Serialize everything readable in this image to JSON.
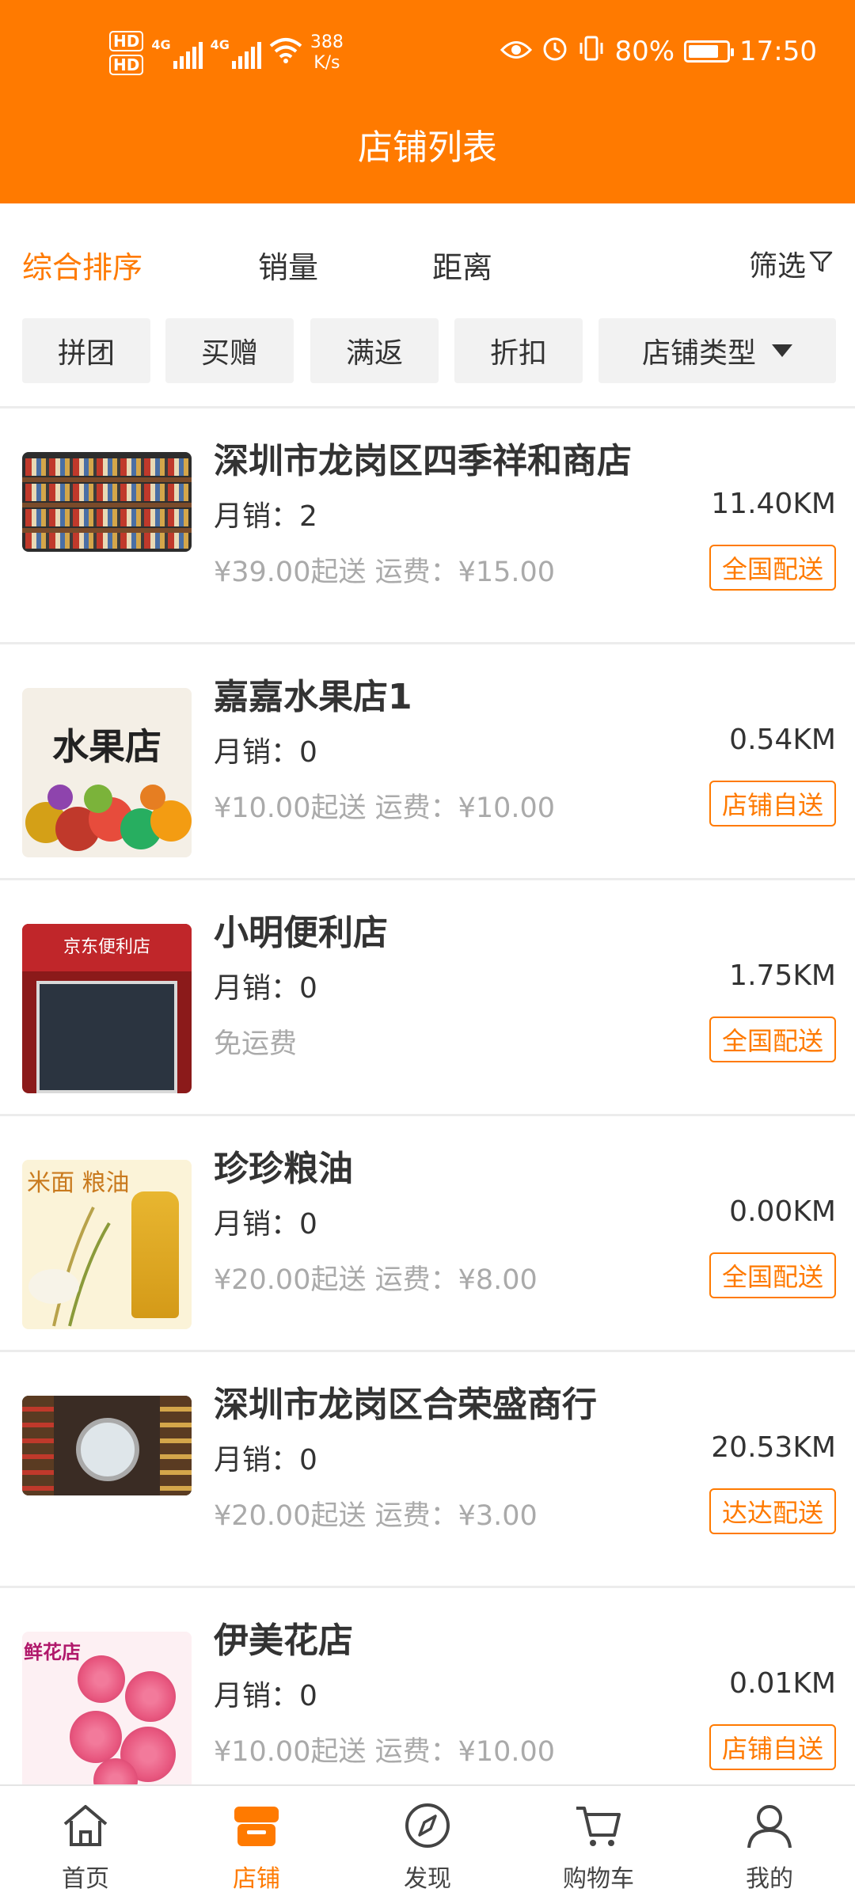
{
  "status_bar": {
    "hd1": "HD",
    "hd2": "HD",
    "signal1": "4G",
    "signal2": "4G",
    "speed_value": "388",
    "speed_unit": "K/s",
    "battery": "80%",
    "battery_level": 0.8,
    "time": "17:50"
  },
  "header": {
    "title": "店铺列表"
  },
  "sort_bar": {
    "items": [
      "综合排序",
      "销量",
      "距离"
    ],
    "active_index": 0,
    "filter_label": "筛选"
  },
  "filter_chips": [
    "拼团",
    "买赠",
    "满返",
    "折扣"
  ],
  "store_type_label": "店铺类型",
  "stores": [
    {
      "name": "深圳市龙岗区四季祥和商店",
      "sales": "月销：2",
      "delivery": "¥39.00起送 运费：¥15.00",
      "distance": "11.40KM",
      "tag": "全国配送"
    },
    {
      "name": "嘉嘉水果店1",
      "sales": "月销：0",
      "delivery": "¥10.00起送 运费：¥10.00",
      "distance": "0.54KM",
      "tag": "店铺自送",
      "image_text": "水果店"
    },
    {
      "name": "小明便利店",
      "sales": "月销：0",
      "delivery": "免运费",
      "distance": "1.75KM",
      "tag": "全国配送",
      "image_text": "京东便利店"
    },
    {
      "name": "珍珍粮油",
      "sales": "月销：0",
      "delivery": "¥20.00起送 运费：¥8.00",
      "distance": "0.00KM",
      "tag": "全国配送",
      "image_text": "米面 粮油"
    },
    {
      "name": "深圳市龙岗区合荣盛商行",
      "sales": "月销：0",
      "delivery": "¥20.00起送 运费：¥3.00",
      "distance": "20.53KM",
      "tag": "达达配送"
    },
    {
      "name": "伊美花店",
      "sales": "月销：0",
      "delivery": "¥10.00起送 运费：¥10.00",
      "distance": "0.01KM",
      "tag": "店铺自送",
      "image_text": "鲜花店"
    }
  ],
  "bottom_nav": {
    "items": [
      {
        "label": "首页",
        "icon": "home-icon"
      },
      {
        "label": "店铺",
        "icon": "store-icon"
      },
      {
        "label": "发现",
        "icon": "compass-icon"
      },
      {
        "label": "购物车",
        "icon": "cart-icon"
      },
      {
        "label": "我的",
        "icon": "user-icon"
      }
    ],
    "active_index": 1
  },
  "colors": {
    "accent": "#FF7A00",
    "muted_text": "#aaaaaa",
    "chip_bg": "#f2f2f2"
  }
}
